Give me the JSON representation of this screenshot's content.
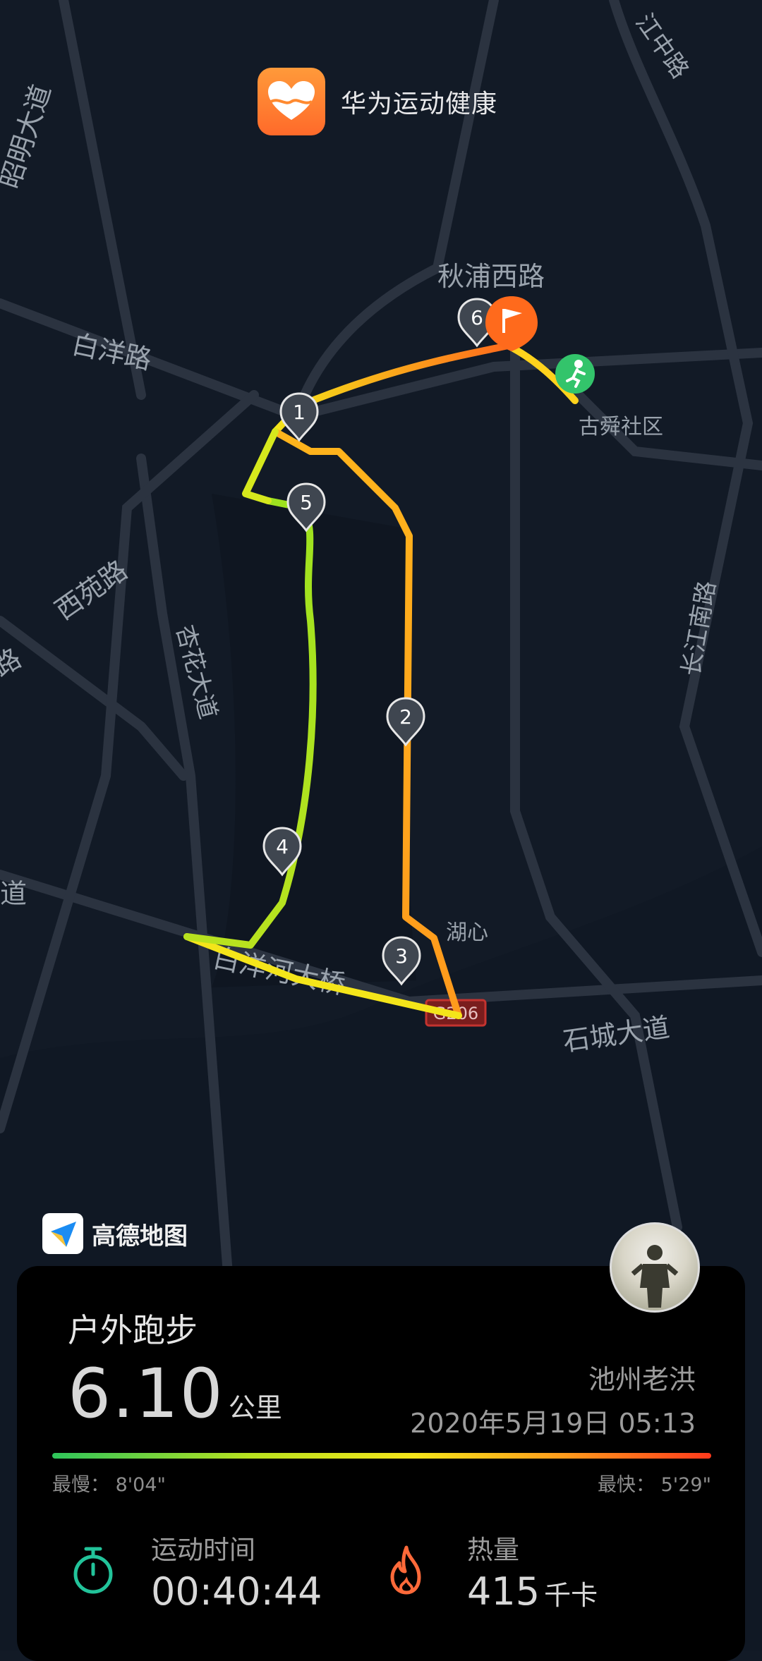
{
  "header": {
    "app_name": "华为运动健康"
  },
  "map": {
    "provider": "高德地图",
    "road_labels": {
      "qiupu_west": "秋浦西路",
      "baiyang_road": "白洋路",
      "zhaoming_ave": "昭明大道",
      "xingzhong": "江中路",
      "xingzhong2": "江中路",
      "xiyuan_road": "西苑路",
      "xinghua_ave": "杏花大道",
      "changjiang_south": "长江南路",
      "shicheng_ave": "石城大道",
      "baiyanghe_bridge": "白洋河大桥",
      "gushun": "古舜社区",
      "huxin": "湖心",
      "highway": "G206",
      "left_edge": "道",
      "left_edge2": "路"
    },
    "km_markers": [
      "1",
      "2",
      "3",
      "4",
      "5",
      "6"
    ],
    "colors": {
      "background": "#121a26",
      "road": "#2b3340",
      "fast": "#ff3a1c",
      "slow": "#2ec55b"
    }
  },
  "workout": {
    "type": "户外跑步",
    "distance": "6.10",
    "distance_unit": "公里",
    "user_name": "池州老洪",
    "date_time": "2020年5月19日 05:13",
    "pace_slowest": "最慢：  8'04\"",
    "pace_fastest": "最快：  5'29\"",
    "duration_label": "运动时间",
    "duration_value": "00:40:44",
    "calories_label": "热量",
    "calories_value": "415",
    "calories_unit": "千卡"
  },
  "icons": {
    "app": "heart-icon",
    "start": "runner-icon",
    "finish": "flag-icon",
    "duration": "stopwatch-icon",
    "calories": "flame-icon"
  }
}
